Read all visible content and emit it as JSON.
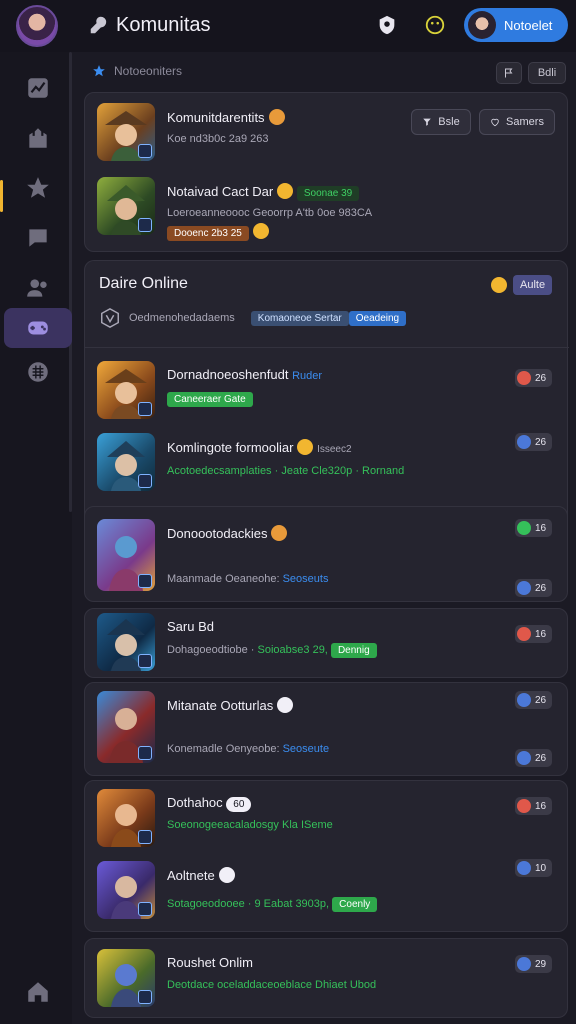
{
  "header": {
    "title": "Komunitas",
    "button_label": "Notoelet"
  },
  "crumb": {
    "label": "Notoeoniters",
    "chip_right": "Bdli"
  },
  "featured": {
    "items": [
      {
        "title": "Komunitdarentits",
        "subtitle": "Koe nd3b0c 2a9 263"
      },
      {
        "title": "Notaivad Cact Dar",
        "title_tag": "Soonae 39",
        "subtitle": "Loeroeanneoooc Geoorrp A'tb 0oe 983CA",
        "chip": "Dooenc 2b3 25"
      }
    ],
    "btn_edit": "Bsle",
    "btn_share": "Samers"
  },
  "online": {
    "title": "Daire Online",
    "badge": "Aulte",
    "filter_label": "Oedmenohedadaems",
    "filter_tag1": "Komaoneoe Sertar",
    "filter_tag2": "Oeadeing"
  },
  "list": [
    {
      "title": "Dornadnoeoshenfudt",
      "title_tag": "Ruder",
      "subtitle_tag": "Caneeraer Gate",
      "pill": "26"
    },
    {
      "title": "Komlingote formooliar",
      "title_tag": "Isseec2",
      "subtitle": "Acotoedecsamplaties · Jeate Cle320p · Rornand",
      "pill": "26"
    },
    {
      "title": "Donoootodackies",
      "subtitle": "Maanmade Oeaneohe:",
      "subtitle_link": "Seoseuts",
      "pill1": "16",
      "pill2": "26"
    },
    {
      "title": "Saru Bd",
      "subtitle": "Dohagoeodtiobe ·",
      "subtitle_green": "Soioabse3 29,",
      "subtitle_tag": "Dennig",
      "pill": "16"
    },
    {
      "title": "Mitanate Ootturlas",
      "subtitle": "Konemadle Oenyeobe:",
      "subtitle_link": "Seoseute",
      "pill1": "26",
      "pill2": "26"
    },
    {
      "title": "Dothahoc",
      "title_tag": "60",
      "subtitle": "Soeonogeeacaladosgy",
      "subtitle_green": "Kla ISeme",
      "pill": "16"
    },
    {
      "title": "Aoltnete",
      "subtitle": "Sotagoeodooee · 9 Eabat 3903p,",
      "subtitle_tag": "Coenly",
      "pill": "10"
    },
    {
      "title": "Roushet Onlim",
      "subtitle": "Deotdace oceladdaceoeblace Dhiaet Ubod",
      "pill": "29"
    }
  ],
  "colors": {
    "accent": "#2f7be0",
    "background": "#1b1a24",
    "card": "#25242f",
    "green": "#35c05a"
  }
}
